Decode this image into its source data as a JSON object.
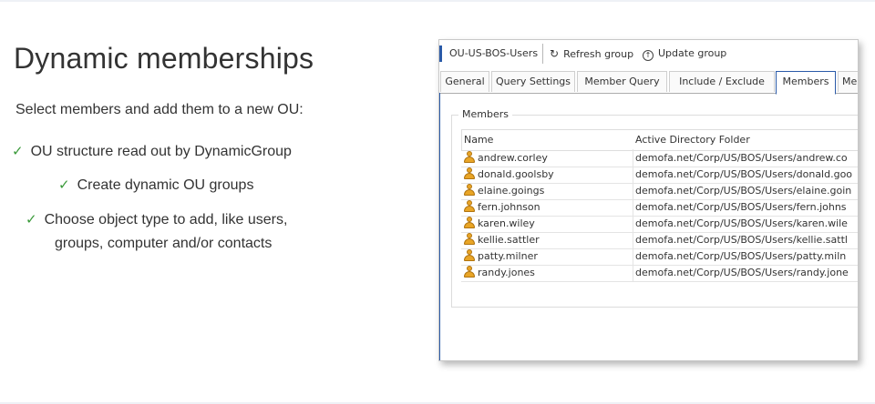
{
  "slide": {
    "title": "Dynamic memberships",
    "subtitle": "Select members and add them to a new OU:",
    "bullets": [
      "OU structure read out by DynamicGroup",
      "Create dynamic OU groups",
      "Choose object type to add, like users,",
      "groups, computer and/or contacts"
    ],
    "check_color": "#3a9a3a"
  },
  "window": {
    "toolbar": {
      "group_name": "OU-US-BOS-Users",
      "refresh_label": "Refresh group",
      "update_label": "Update group"
    },
    "tabs": [
      "General",
      "Query Settings",
      "Member Query",
      "Include / Exclude",
      "Members",
      "Me"
    ],
    "active_tab": "Members",
    "members_group": {
      "label": "Members",
      "columns": [
        "Name",
        "Active Directory Folder"
      ],
      "rows": [
        {
          "name": "andrew.corley",
          "folder": "demofa.net/Corp/US/BOS/Users/andrew.co"
        },
        {
          "name": "donald.goolsby",
          "folder": "demofa.net/Corp/US/BOS/Users/donald.goo"
        },
        {
          "name": "elaine.goings",
          "folder": "demofa.net/Corp/US/BOS/Users/elaine.goin"
        },
        {
          "name": "fern.johnson",
          "folder": "demofa.net/Corp/US/BOS/Users/fern.johns"
        },
        {
          "name": "karen.wiley",
          "folder": "demofa.net/Corp/US/BOS/Users/karen.wile"
        },
        {
          "name": "kellie.sattler",
          "folder": "demofa.net/Corp/US/BOS/Users/kellie.sattl"
        },
        {
          "name": "patty.milner",
          "folder": "demofa.net/Corp/US/BOS/Users/patty.miln"
        },
        {
          "name": "randy.jones",
          "folder": "demofa.net/Corp/US/BOS/Users/randy.jone"
        }
      ]
    },
    "accent_color": "#2a5aa8",
    "user_icon_color": "#e9a526"
  }
}
